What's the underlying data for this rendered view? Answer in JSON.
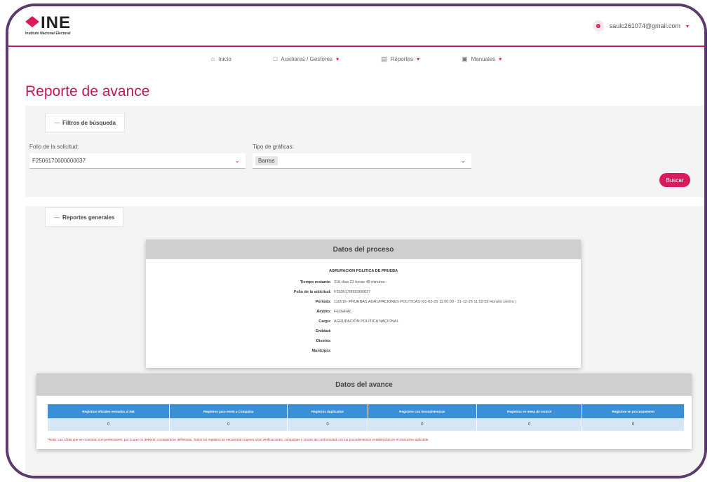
{
  "header": {
    "logo_text": "INE",
    "logo_subtitle": "Instituto Nacional Electoral",
    "user_email": "saulc261074@gmail.com",
    "user_caret": "▾"
  },
  "nav": {
    "items": [
      {
        "label": "Inicio",
        "icon": "home-icon",
        "caret": ""
      },
      {
        "label": "Auxiliares / Gestores",
        "icon": "document-icon",
        "caret": "▾"
      },
      {
        "label": "Reportes",
        "icon": "chart-icon",
        "caret": "▾"
      },
      {
        "label": "Manuales",
        "icon": "book-icon",
        "caret": "▾"
      }
    ]
  },
  "page": {
    "title": "Reporte de avance"
  },
  "filters": {
    "legend": "Filtros de búsqueda",
    "folio_label": "Folio de la solicitud:",
    "folio_value": "F2506170000000037",
    "tipo_label": "Tipo de gráficas:",
    "tipo_value": "Barras",
    "buscar_label": "Buscar"
  },
  "reports": {
    "legend": "Reportes generales"
  },
  "proceso": {
    "title": "Datos del proceso",
    "organizacion": "AGRUPACION POLITICA DE PRUEBA",
    "rows": [
      {
        "key": "Tiempo restante:",
        "value": "316 días  23 horas  48 minutos"
      },
      {
        "key": "Folio de la solicitud:",
        "value": "F2506170000000037"
      },
      {
        "key": "Periodo:",
        "value": "11/2/16- PRUEBAS AGRUPACIONES POLITICAS (01-02-25 11:00:00 - 31-12-25 11:59:59 Horario centro )"
      },
      {
        "key": "Ámbito:",
        "value": "FEDERAL"
      },
      {
        "key": "Cargo:",
        "value": "AGRUPACIÓN POLÍTICA NACIONAL"
      },
      {
        "key": "Entidad:",
        "value": ""
      },
      {
        "key": "Distrito:",
        "value": ""
      },
      {
        "key": "Municipio:",
        "value": ""
      }
    ]
  },
  "avance": {
    "title": "Datos del avance",
    "columns": [
      "Registros oficiales enviados al INE",
      "Registros para envío a Compulsa",
      "Registros duplicados",
      "Registros con inconsistencias",
      "Registros en mesa de control",
      "Registros en procesamiento"
    ],
    "values": [
      "0",
      "0",
      "0",
      "0",
      "0",
      "0"
    ],
    "nota": "*Nota: Las cifras que se muestran son preliminares, por lo que no deberán considerarse definitivas. Todos los registros se encuentran sujetos a las verificaciones, compulsas y cruces de conformidad con los procedimientos establecidos en el instructivo aplicable."
  },
  "colors": {
    "brand": "#d81b60",
    "frame": "#5b3a6e",
    "table_header": "#3a8fd6",
    "nota": "#c62828"
  }
}
